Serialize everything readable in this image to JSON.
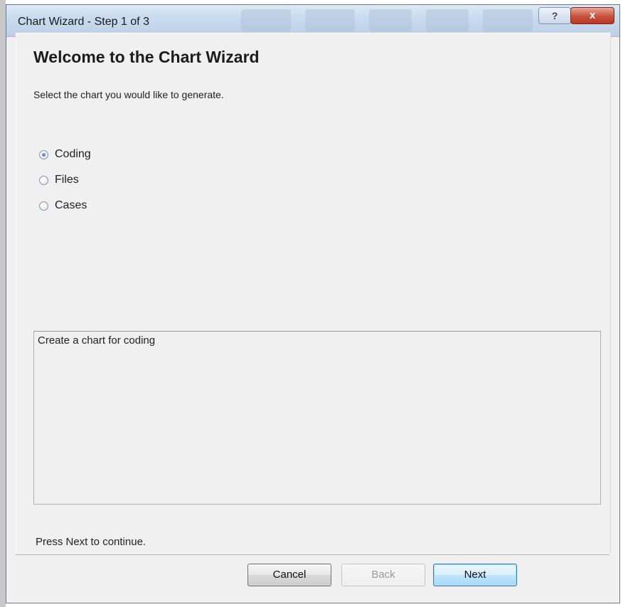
{
  "window": {
    "title": "Chart Wizard - Step 1 of 3",
    "help_symbol": "?",
    "close_symbol": "x"
  },
  "page": {
    "heading": "Welcome to the Chart Wizard",
    "instruction": "Select the chart you would like to generate."
  },
  "chart_options": [
    {
      "label": "Coding",
      "selected": true
    },
    {
      "label": "Files",
      "selected": false
    },
    {
      "label": "Cases",
      "selected": false
    }
  ],
  "description": "Create a chart for coding",
  "footer_hint": "Press Next to continue.",
  "buttons": {
    "cancel": "Cancel",
    "back": "Back",
    "next": "Next"
  },
  "colors": {
    "close_button": "#c9503b",
    "default_button_border": "#3c7fb1"
  }
}
